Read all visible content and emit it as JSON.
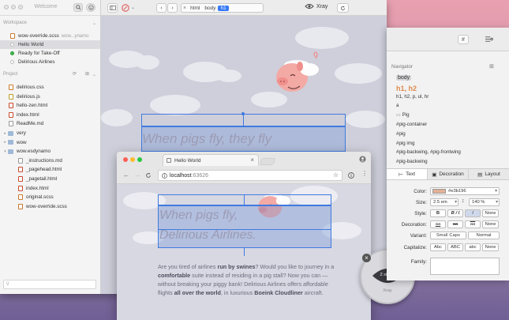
{
  "window": {
    "title": "Welcome"
  },
  "sidebar": {
    "workspace_label": "Workspace",
    "workspace_items": [
      {
        "label": "wow-override.scss",
        "extra": "wow...ynamo",
        "icon": "scss",
        "selected": false
      },
      {
        "label": "Hello World",
        "extra": "",
        "icon": "status-white",
        "selected": true
      },
      {
        "label": "Ready for Take-Off",
        "extra": "",
        "icon": "status-green",
        "selected": false
      },
      {
        "label": "Delirious Airlines",
        "extra": "",
        "icon": "status-white",
        "selected": false
      }
    ],
    "project_label": "Project",
    "project_items": [
      {
        "label": "delirious.css",
        "type": "css",
        "indent": 0
      },
      {
        "label": "delirious.js",
        "type": "js",
        "indent": 0
      },
      {
        "label": "hello-zen.html",
        "type": "html",
        "indent": 0
      },
      {
        "label": "index.html",
        "type": "html",
        "indent": 0
      },
      {
        "label": "ReadMe.md",
        "type": "md",
        "indent": 0
      },
      {
        "label": "very",
        "type": "folder",
        "indent": 0
      },
      {
        "label": "wow",
        "type": "folder",
        "indent": 0
      },
      {
        "label": "wow.esdynamo",
        "type": "folder-open",
        "indent": 0
      },
      {
        "label": "_instructions.md",
        "type": "md",
        "indent": 1
      },
      {
        "label": "_pagehead.html",
        "type": "html",
        "indent": 1
      },
      {
        "label": "_pagetail.html",
        "type": "html",
        "indent": 1
      },
      {
        "label": "index.html",
        "type": "html",
        "indent": 1
      },
      {
        "label": "original.scss",
        "type": "css",
        "indent": 1
      },
      {
        "label": "wow-override.scss",
        "type": "css",
        "indent": 1
      }
    ]
  },
  "toolbar": {
    "breadcrumbs": [
      "html",
      "body",
      "h1"
    ],
    "xray_label": "Xray"
  },
  "canvas": {
    "headline": "When pigs fly, they fly"
  },
  "chrome": {
    "tab_title": "Hello World",
    "url_host": "localhost",
    "url_port": ":63626",
    "headline_line1": "When pigs fly,",
    "headline_line2": "Delirious Airlines.",
    "paragraph": {
      "p1": "Are you tired of airlines ",
      "b1": "run by swines",
      "p2": "? Would you like to journey in a ",
      "b2": "comfortable",
      "p3": " suite instead of residing in a pig stall? Now you can — without breaking your piggy bank! Delirious Airlines offers affordable flights ",
      "b3": "all over the world",
      "p4": ", in luxurious ",
      "b4": "Boeink Cloudliner",
      "p5": " aircraft."
    }
  },
  "xray_bubble": {
    "count_label": "2 styles",
    "name": "Xray"
  },
  "inspector": {
    "navigator_label": "Navigator",
    "nav_items": [
      {
        "label": "body",
        "style": "tag"
      },
      {
        "label": "h1, h2",
        "style": "accent"
      },
      {
        "label": "h1, h2, p, ul, hr",
        "style": "normal"
      },
      {
        "label": "a",
        "style": "normal"
      },
      {
        "label": "Pig",
        "style": "group"
      },
      {
        "label": "#pig-container",
        "style": "normal"
      },
      {
        "label": "#pig",
        "style": "normal"
      },
      {
        "label": "#pig img",
        "style": "normal"
      },
      {
        "label": "#pig-backwing, #pig-frontwing",
        "style": "normal"
      },
      {
        "label": "#pig-backwing",
        "style": "normal"
      }
    ],
    "tabs": [
      "Text",
      "Decoration",
      "Layout"
    ],
    "active_tab": "Text",
    "fields": {
      "color_label": "Color:",
      "color_value": "#e3b196",
      "color_swatch": "#e3b196",
      "size_label": "Size:",
      "size_value": "2.5",
      "size_unit": "em",
      "line_height": "140",
      "line_height_unit": "%",
      "style_label": "Style:",
      "style_opts": [
        "B",
        "B / I",
        "I",
        "None"
      ],
      "decoration_label": "Decoration:",
      "decoration_opts": [
        "aa",
        "aa",
        "aa",
        "None"
      ],
      "variant_label": "Variant:",
      "variant_opts": [
        "Small Caps",
        "Normal"
      ],
      "capitalize_label": "Capitalize:",
      "capitalize_opts": [
        "Abc",
        "ABC",
        "abc",
        "None"
      ],
      "family_label": "Family:"
    }
  },
  "colors": {
    "accent": "#3478f6",
    "selector_accent": "#e08a4f",
    "h1_color": "#e3b196"
  }
}
